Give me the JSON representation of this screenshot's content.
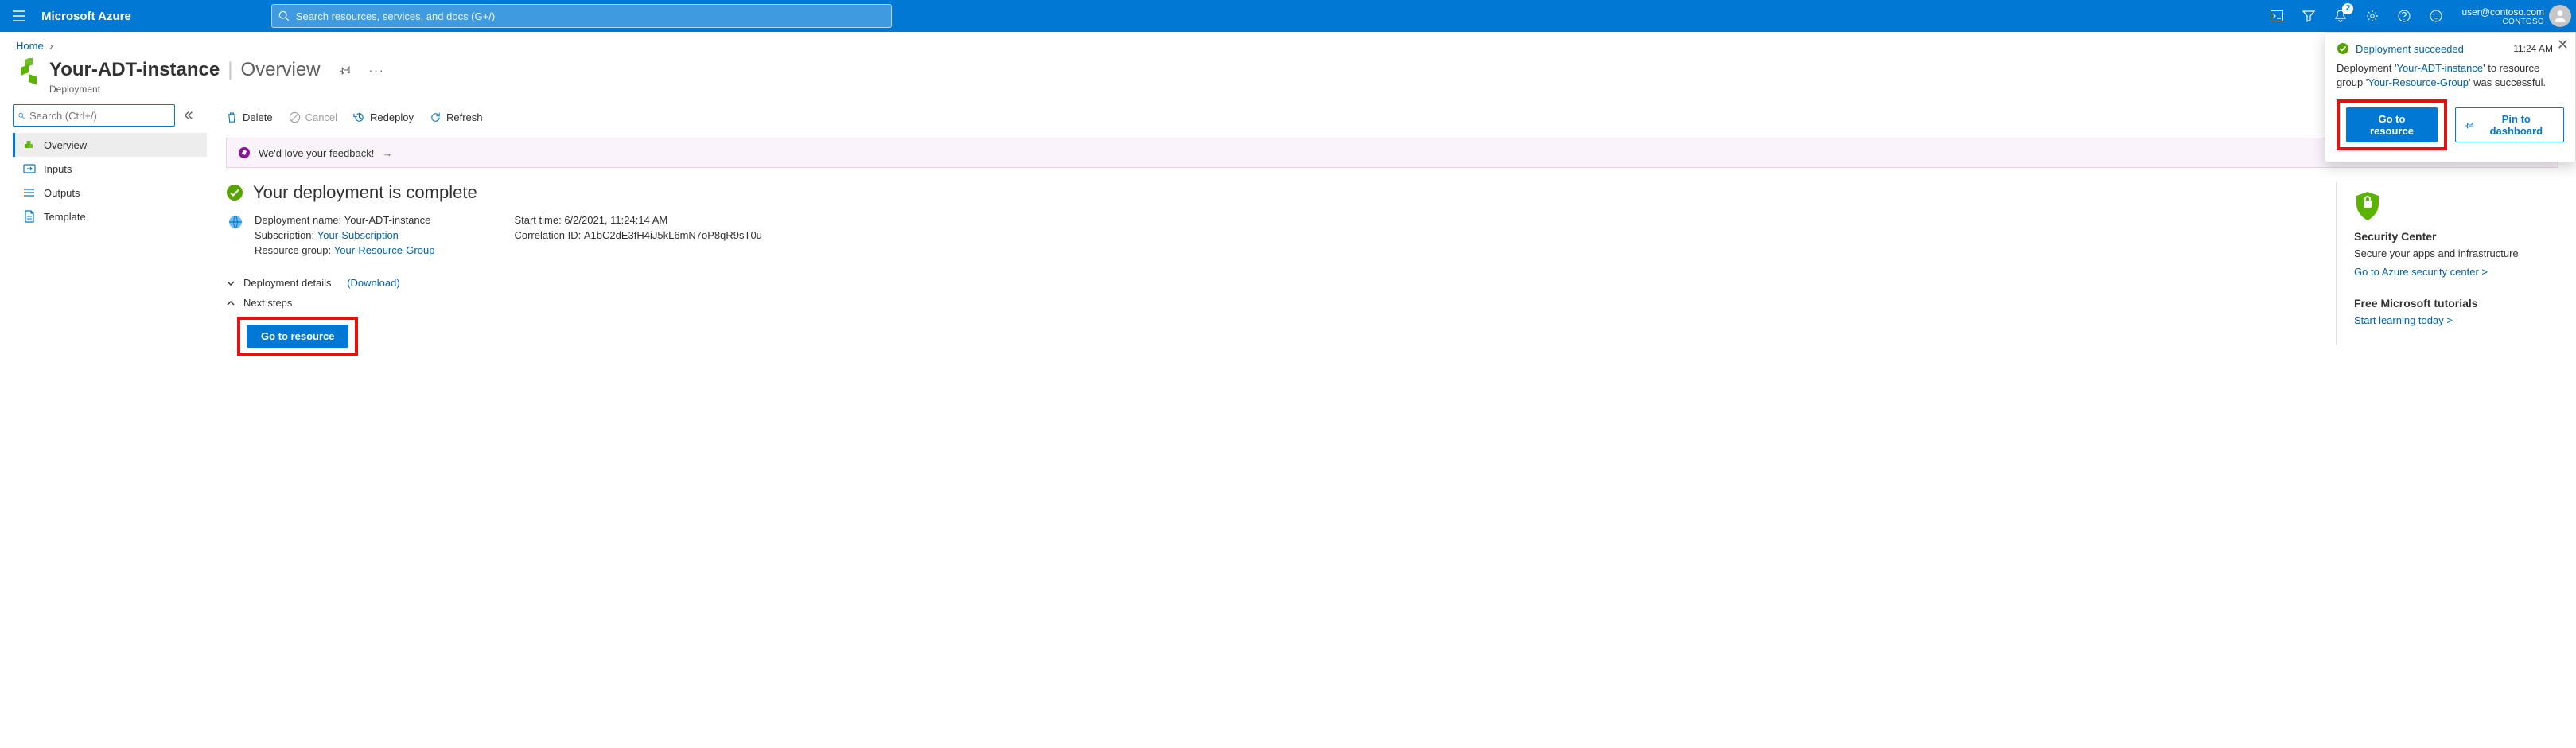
{
  "topbar": {
    "brand": "Microsoft Azure",
    "search_placeholder": "Search resources, services, and docs (G+/)",
    "notification_count": "2",
    "account_email": "user@contoso.com",
    "account_tenant": "CONTOSO"
  },
  "breadcrumb": {
    "home": "Home"
  },
  "header": {
    "resource_name": "Your-ADT-instance",
    "subtitle": "Overview",
    "type": "Deployment"
  },
  "sidebar": {
    "search_placeholder": "Search (Ctrl+/)",
    "items": [
      {
        "label": "Overview",
        "icon": "overview"
      },
      {
        "label": "Inputs",
        "icon": "inputs"
      },
      {
        "label": "Outputs",
        "icon": "outputs"
      },
      {
        "label": "Template",
        "icon": "template"
      }
    ]
  },
  "cmdbar": {
    "delete": "Delete",
    "cancel": "Cancel",
    "redeploy": "Redeploy",
    "refresh": "Refresh"
  },
  "feedback": {
    "text": "We'd love your feedback!"
  },
  "status": {
    "title": "Your deployment is complete"
  },
  "details": {
    "deployment_name_label": "Deployment name:",
    "deployment_name": "Your-ADT-instance",
    "subscription_label": "Subscription:",
    "subscription": "Your-Subscription",
    "resource_group_label": "Resource group:",
    "resource_group": "Your-Resource-Group",
    "start_time_label": "Start time:",
    "start_time": "6/2/2021, 11:24:14 AM",
    "correlation_label": "Correlation ID:",
    "correlation": "A1bC2dE3fH4iJ5kL6mN7oP8qR9sT0u"
  },
  "sections": {
    "deployment_details": "Deployment details",
    "download": "(Download)",
    "next_steps": "Next steps",
    "go_to_resource": "Go to resource"
  },
  "right": {
    "security_title": "Security Center",
    "security_sub": "Secure your apps and infrastructure",
    "security_link": "Go to Azure security center >",
    "tutorials_title": "Free Microsoft tutorials",
    "tutorials_link": "Start learning today >"
  },
  "toast": {
    "title": "Deployment succeeded",
    "time": "11:24 AM",
    "body_prefix": "Deployment '",
    "body_link1": "Your-ADT-instance",
    "body_mid": "' to resource group '",
    "body_link2": "Your-Resource-Group",
    "body_suffix": "' was successful.",
    "go_to_resource": "Go to resource",
    "pin": "Pin to dashboard"
  }
}
